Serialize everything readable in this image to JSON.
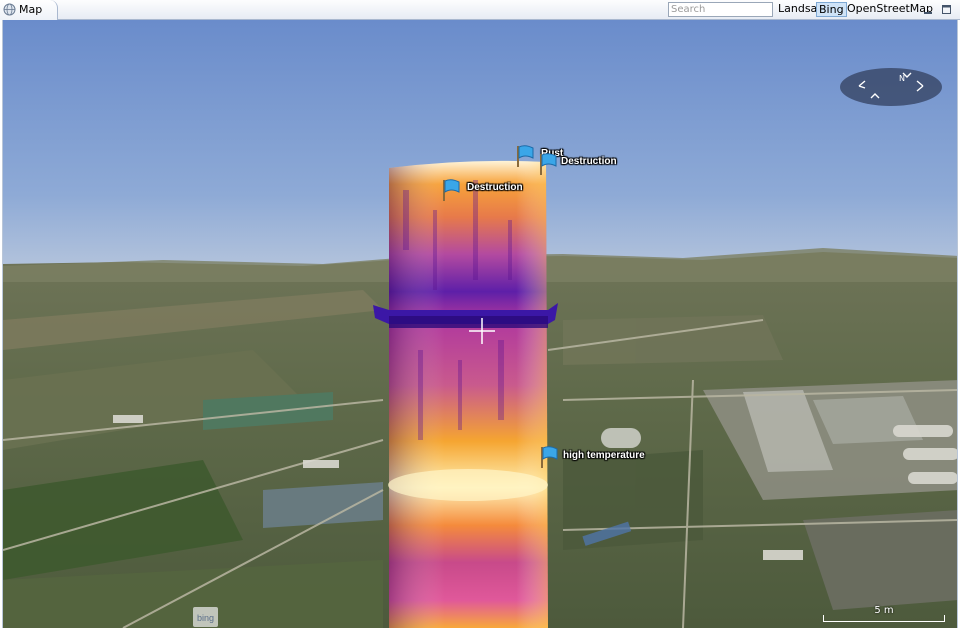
{
  "tab": {
    "label": "Map"
  },
  "search": {
    "placeholder": "Search"
  },
  "layers": [
    {
      "label": "Landsat",
      "selected": false
    },
    {
      "label": "Bing",
      "selected": true
    },
    {
      "label": "OpenStreetMap",
      "selected": false
    }
  ],
  "markers": [
    {
      "label": "Rust"
    },
    {
      "label": "Destruction"
    },
    {
      "label": "Destruction"
    },
    {
      "label": "high temperature"
    }
  ],
  "attribution": {
    "logo_text": "bing"
  },
  "scale": {
    "label": "5 m"
  },
  "colors": {
    "sky_top": "#6b8ec9",
    "sky_horizon": "#aebfd8",
    "thermal_low": "#6a1fa6",
    "thermal_mid": "#e0499a",
    "thermal_high": "#ffb01a",
    "thermal_peak": "#fff2c0",
    "flag_blue": "#3aa6e8"
  }
}
